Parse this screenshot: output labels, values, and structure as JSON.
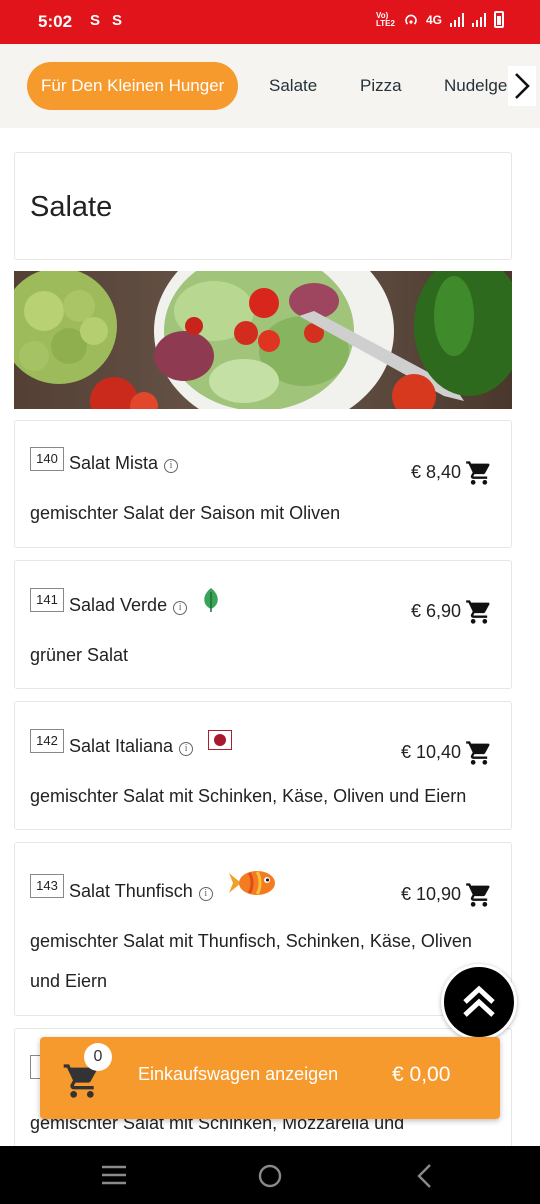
{
  "status_bar": {
    "time": "5:02",
    "indicators": [
      "S",
      "S"
    ],
    "network_label": "Vo) LTE2",
    "network_type": "4G",
    "bg_color": "#e2141b"
  },
  "category_tabs": {
    "items": [
      {
        "label": "Für Den Kleinen Hunger",
        "active": true
      },
      {
        "label": "Salate",
        "active": false
      },
      {
        "label": "Pizza",
        "active": false
      },
      {
        "label": "Nudelge",
        "active": false
      }
    ],
    "next_icon": "chevron-right-icon",
    "accent_color": "#f79a2e"
  },
  "section": {
    "title": "Salate",
    "banner_image": "salad-photo"
  },
  "menu_items": [
    {
      "number": "140",
      "name": "Salat Mista",
      "price": "€ 8,40",
      "description": "gemischter Salat der Saison mit Oliven",
      "diet_icon": null
    },
    {
      "number": "141",
      "name": "Salad Verde",
      "price": "€ 6,90",
      "description": "grüner Salat",
      "diet_icon": "vegetarian-leaf-icon"
    },
    {
      "number": "142",
      "name": "Salat Italiana",
      "price": "€ 10,40",
      "description": "gemischter Salat mit Schinken, Käse, Oliven und Eiern",
      "diet_icon": "meat-icon"
    },
    {
      "number": "143",
      "name": "Salat Thunfisch",
      "price": "€ 10,90",
      "description": "gemischter Salat mit Thunfisch, Schinken, Käse, Oliven und Eiern",
      "diet_icon": "fish-icon"
    },
    {
      "number": "1",
      "name": "",
      "price": "",
      "description": "gemischter Salat mit Schinken, Mozzarella und",
      "diet_icon": null
    }
  ],
  "cart": {
    "count": "0",
    "label": "Einkaufswagen anzeigen",
    "total": "€ 0,00"
  },
  "scroll_top": {
    "icon": "double-chevron-up-icon"
  },
  "nav_bar": {
    "icons": [
      "menu-icon",
      "home-icon",
      "back-icon"
    ]
  }
}
